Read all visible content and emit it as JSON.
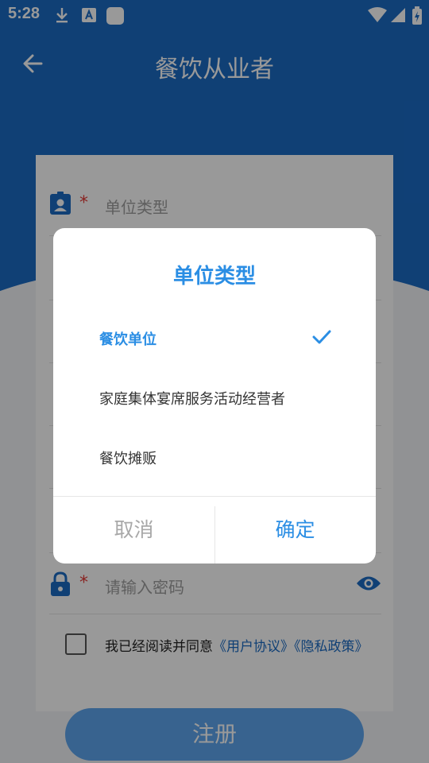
{
  "status_bar": {
    "time": "5:28"
  },
  "toolbar": {
    "title": "餐饮从业者"
  },
  "form": {
    "unit_type_placeholder": "单位类型",
    "password_placeholder": "请输入密码",
    "required_mark": "*",
    "agree": {
      "prefix": "我已经阅读并同意",
      "user_agreement": "《用户协议》",
      "privacy_policy": "《隐私政策》"
    },
    "register_label": "注册"
  },
  "dialog": {
    "title": "单位类型",
    "options": [
      {
        "label": "餐饮单位",
        "selected": true
      },
      {
        "label": "家庭集体宴席服务活动经营者",
        "selected": false
      },
      {
        "label": "餐饮摊贩",
        "selected": false
      }
    ],
    "cancel_label": "取消",
    "confirm_label": "确定"
  },
  "colors": {
    "primary": "#1b6bc4",
    "accent": "#2b8ee4",
    "required": "#e53935"
  },
  "icons": {
    "back": "arrow-left-icon",
    "unit_type": "id-badge-icon",
    "password": "lock-icon",
    "visibility": "eye-icon",
    "selected": "check-icon"
  }
}
